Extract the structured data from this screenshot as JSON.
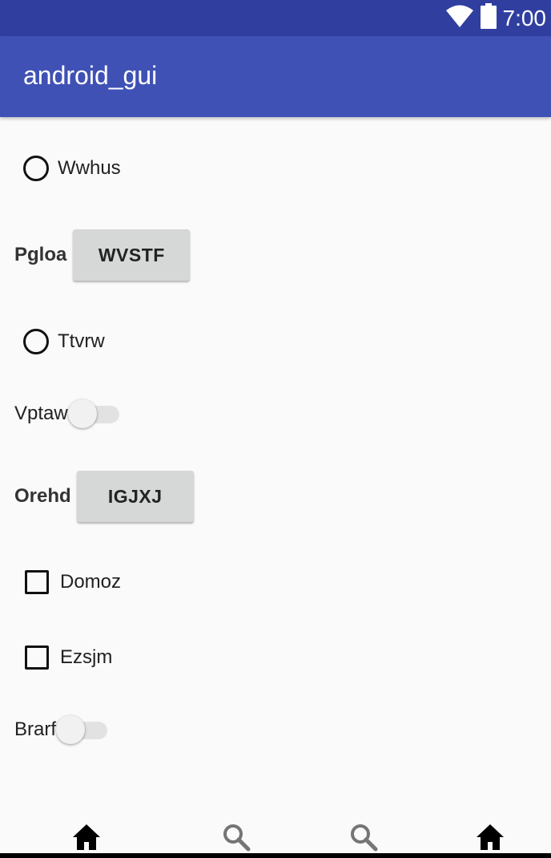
{
  "status_bar": {
    "time": "7:00",
    "icons": [
      "wifi-icon",
      "battery-icon"
    ],
    "background": "#303f9f"
  },
  "app_bar": {
    "title": "android_gui",
    "background": "#3f51b5"
  },
  "widgets": {
    "radio_1": {
      "label": "Wwhus",
      "checked": false
    },
    "button_row_1": {
      "label": "Pgloa",
      "button_text": "WVSTF"
    },
    "radio_2": {
      "label": "Ttvrw",
      "checked": false
    },
    "switch_1": {
      "label": "Vptaw",
      "on": false
    },
    "button_row_2": {
      "label": "Orehd",
      "button_text": "IGJXJ"
    },
    "checkbox_1": {
      "label": "Domoz",
      "checked": false
    },
    "checkbox_2": {
      "label": "Ezsjm",
      "checked": false
    },
    "switch_2": {
      "label": "Brarf",
      "on": false
    }
  },
  "bottom_nav": {
    "items": [
      "home-icon",
      "search-icon",
      "search-icon",
      "home-icon"
    ]
  }
}
